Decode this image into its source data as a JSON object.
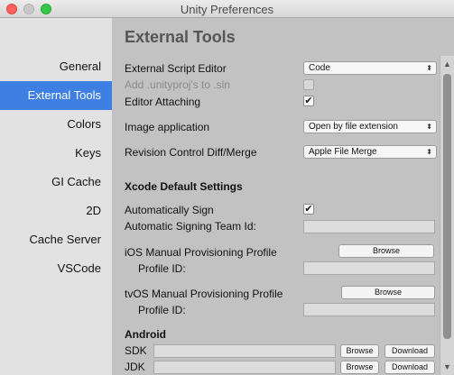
{
  "window": {
    "title": "Unity Preferences"
  },
  "sidebar": {
    "items": [
      {
        "label": "General"
      },
      {
        "label": "External Tools"
      },
      {
        "label": "Colors"
      },
      {
        "label": "Keys"
      },
      {
        "label": "GI Cache"
      },
      {
        "label": "2D"
      },
      {
        "label": "Cache Server"
      },
      {
        "label": "VSCode"
      }
    ],
    "selected": "External Tools"
  },
  "main": {
    "heading": "External Tools",
    "external_script_editor": {
      "label": "External Script Editor",
      "value": "Code"
    },
    "add_unityproj": {
      "label": "Add .unityproj's to .sln",
      "checked": false,
      "disabled": true
    },
    "editor_attaching": {
      "label": "Editor Attaching",
      "checked": true
    },
    "image_application": {
      "label": "Image application",
      "value": "Open by file extension"
    },
    "revision_control": {
      "label": "Revision Control Diff/Merge",
      "value": "Apple File Merge"
    },
    "xcode": {
      "heading": "Xcode Default Settings",
      "automatically_sign": {
        "label": "Automatically Sign",
        "checked": true
      },
      "signing_team_id": {
        "label": "Automatic Signing Team Id:",
        "value": ""
      },
      "ios_profile": {
        "label": "iOS Manual Provisioning Profile",
        "browse": "Browse",
        "profile_id_label": "Profile ID:",
        "profile_id": ""
      },
      "tvos_profile": {
        "label": "tvOS Manual Provisioning Profile",
        "browse": "Browse",
        "profile_id_label": "Profile ID:",
        "profile_id": ""
      }
    },
    "android": {
      "heading": "Android",
      "sdk": {
        "label": "SDK",
        "value": "",
        "browse": "Browse",
        "download": "Download"
      },
      "jdk": {
        "label": "JDK",
        "value": "",
        "browse": "Browse",
        "download": "Download"
      }
    }
  },
  "icons": {
    "checkmark": "✔",
    "popup_arrows": "⬍",
    "scroll_up": "▲",
    "scroll_down": "▼"
  },
  "colors": {
    "selection": "#3d7fe3"
  }
}
